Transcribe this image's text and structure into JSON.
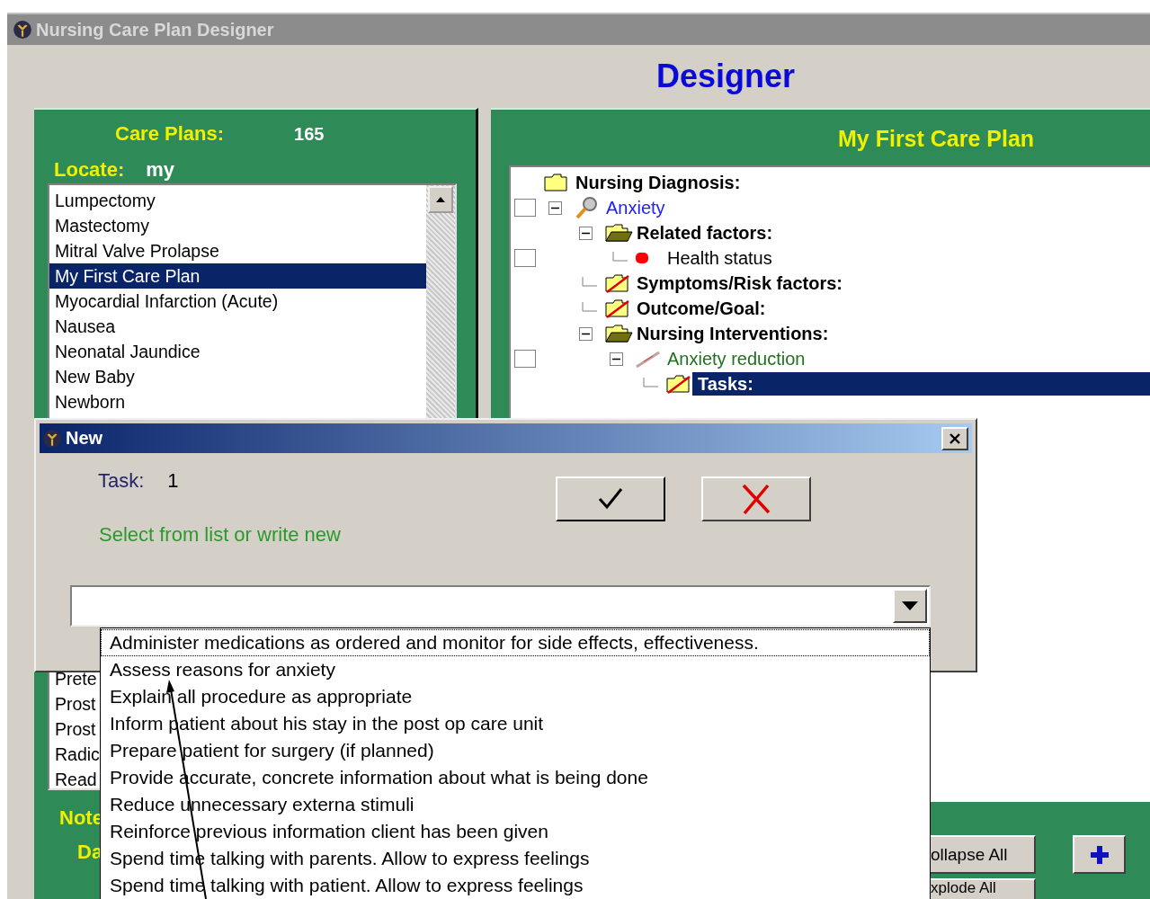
{
  "window": {
    "title": "Nursing Care Plan Designer"
  },
  "heading": "Designer",
  "care_plans": {
    "label": "Care Plans:",
    "count": "165",
    "locate_label": "Locate:",
    "locate_value": "my",
    "items": [
      {
        "label": "Lumpectomy",
        "selected": false
      },
      {
        "label": "Mastectomy",
        "selected": false
      },
      {
        "label": "Mitral Valve Prolapse",
        "selected": false
      },
      {
        "label": "My First Care Plan",
        "selected": true
      },
      {
        "label": "Myocardial Infarction (Acute)",
        "selected": false
      },
      {
        "label": "Nausea",
        "selected": false
      },
      {
        "label": "Neonatal Jaundice",
        "selected": false
      },
      {
        "label": "New Baby",
        "selected": false
      },
      {
        "label": "Newborn",
        "selected": false
      }
    ],
    "lower_items": [
      {
        "label": "Prete",
        "selected": false
      },
      {
        "label": "Prost",
        "selected": false
      },
      {
        "label": "Prost",
        "selected": false
      },
      {
        "label": "Radic",
        "selected": false
      },
      {
        "label": "Read",
        "selected": false
      }
    ],
    "notes_label": "Note",
    "date_label": "Da"
  },
  "plan": {
    "title": "My First Care Plan",
    "tree": [
      {
        "label": "Nursing Diagnosis:",
        "kind": "section",
        "selected": false,
        "children": [
          {
            "label": "Anxiety",
            "kind": "diagnosis",
            "checked": false,
            "expanded": true,
            "selected": false,
            "children": [
              {
                "label": "Related factors:",
                "kind": "section",
                "expanded": true,
                "selected": false,
                "children": [
                  {
                    "label": "Health status",
                    "kind": "factor",
                    "checked": false,
                    "selected": false
                  }
                ]
              },
              {
                "label": "Symptoms/Risk factors:",
                "kind": "empty-section",
                "selected": false
              },
              {
                "label": "Outcome/Goal:",
                "kind": "empty-section",
                "selected": false
              },
              {
                "label": "Nursing Interventions:",
                "kind": "section",
                "expanded": true,
                "selected": false,
                "children": [
                  {
                    "label": "Anxiety reduction",
                    "kind": "intervention",
                    "checked": false,
                    "expanded": true,
                    "selected": false,
                    "children": [
                      {
                        "label": "Tasks:",
                        "kind": "empty-section",
                        "selected": true
                      }
                    ]
                  }
                ]
              }
            ]
          }
        ]
      }
    ],
    "collapse_button": "ollapse All",
    "explode_button": "xplode All"
  },
  "dialog": {
    "title": "New",
    "task_label": "Task:",
    "task_value": "1",
    "hint": "Select from list or write new",
    "options": [
      {
        "label": "Administer medications as ordered and monitor for side effects, effectiveness.",
        "focused": true
      },
      {
        "label": "Assess reasons for anxiety",
        "focused": false
      },
      {
        "label": "Explain all procedure as appropriate",
        "focused": false
      },
      {
        "label": "Inform patient about his stay in the post op care unit",
        "focused": false
      },
      {
        "label": "Prepare patient for surgery (if planned)",
        "focused": false
      },
      {
        "label": "Provide accurate, concrete information about what is being done",
        "focused": false
      },
      {
        "label": "Reduce unnecessary externa stimuli",
        "focused": false
      },
      {
        "label": "Reinforce previous information client has been given",
        "focused": false
      },
      {
        "label": "Spend time talking with parents. Allow to express feelings",
        "focused": false
      },
      {
        "label": "Spend time talking with patient. Allow to express feelings",
        "focused": false
      }
    ]
  }
}
